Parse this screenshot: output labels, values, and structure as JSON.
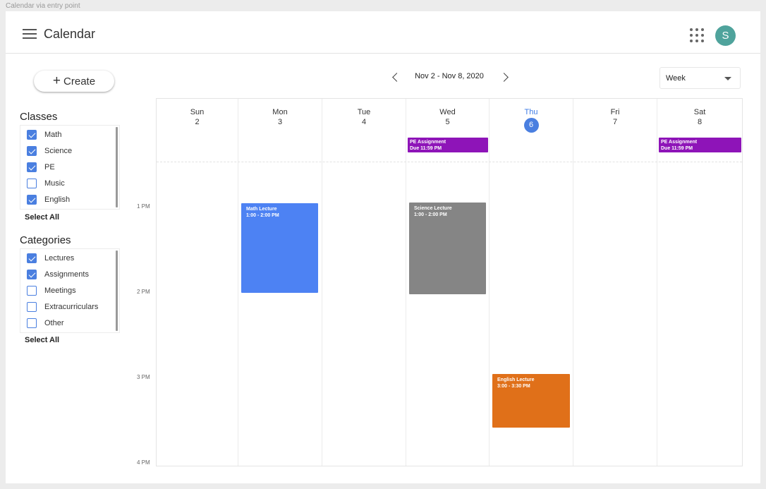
{
  "frame_label": "Calendar via entry point",
  "header": {
    "title": "Calendar",
    "avatar_initial": "S",
    "avatar_color": "#4fa39c"
  },
  "create_label": "Create",
  "classes": {
    "title": "Classes",
    "items": [
      {
        "label": "Math",
        "checked": true
      },
      {
        "label": "Science",
        "checked": true
      },
      {
        "label": "PE",
        "checked": true
      },
      {
        "label": "Music",
        "checked": false
      },
      {
        "label": "English",
        "checked": true
      }
    ],
    "select_all": "Select All"
  },
  "categories": {
    "title": "Categories",
    "items": [
      {
        "label": "Lectures",
        "checked": true
      },
      {
        "label": "Assignments",
        "checked": true
      },
      {
        "label": "Meetings",
        "checked": false
      },
      {
        "label": "Extracurriculars",
        "checked": false
      },
      {
        "label": "Other",
        "checked": false
      }
    ],
    "select_all": "Select All"
  },
  "nav": {
    "date_range": "Nov 2 - Nov 8, 2020",
    "prev_icon": "chevron-left-icon",
    "next_icon": "chevron-right-icon"
  },
  "view_select": {
    "value": "Week"
  },
  "days": [
    {
      "name": "Sun",
      "num": "2",
      "today": false
    },
    {
      "name": "Mon",
      "num": "3",
      "today": false
    },
    {
      "name": "Tue",
      "num": "4",
      "today": false
    },
    {
      "name": "Wed",
      "num": "5",
      "today": false
    },
    {
      "name": "Thu",
      "num": "6",
      "today": true
    },
    {
      "name": "Fri",
      "num": "7",
      "today": false
    },
    {
      "name": "Sat",
      "num": "8",
      "today": false
    }
  ],
  "time_labels": [
    "1 PM",
    "2 PM",
    "3 PM",
    "4 PM"
  ],
  "events": {
    "pe_wed": {
      "title": "PE Assignment",
      "time": "Due 11:59 PM",
      "color": "#8e14b8"
    },
    "pe_sat": {
      "title": "PE Assignment",
      "time": "Due 11:59 PM",
      "color": "#8e14b8"
    },
    "math": {
      "title": "Math Lecture",
      "time": "1:00 - 2:00 PM",
      "color": "#4d82f3"
    },
    "science": {
      "title": "Science Lecture",
      "time": "1:00 - 2:00 PM",
      "color": "#858585"
    },
    "english": {
      "title": "English Lecture",
      "time": "3:00 - 3:30 PM",
      "color": "#e07019"
    }
  },
  "colors": {
    "accent": "#4a7fe0",
    "today": "#3d7be6"
  }
}
